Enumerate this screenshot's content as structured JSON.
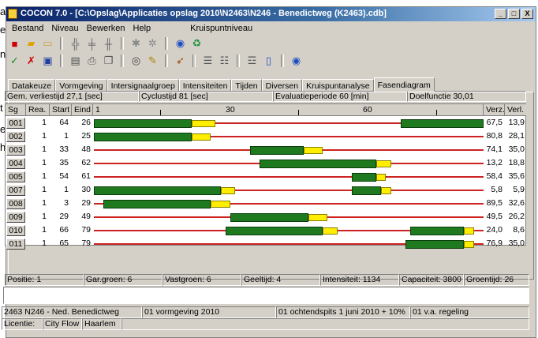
{
  "background_text": [
    "a",
    "e",
    "n",
    "",
    "t",
    "e",
    "h",
    "",
    "",
    "",
    "",
    "",
    "",
    ""
  ],
  "window": {
    "title": "COCON 7.0 - [C:\\Opslag\\Applicaties opslag 2010\\N2463\\N246 - Benedictweg (K2463).cdb]",
    "buttons": [
      "_",
      "□",
      "X"
    ]
  },
  "menu": [
    "Bestand",
    "Niveau",
    "Bewerken",
    "Help",
    "",
    "Kruispuntniveau"
  ],
  "tabs": [
    "Datakeuze",
    "Vormgeving",
    "Intersignaalgroep",
    "Intensiteiten",
    "Tijden",
    "Diversen",
    "Kruispuntanalyse",
    "Fasendiagram"
  ],
  "active_tab": "Fasendiagram",
  "info": {
    "verliestijd": "Gem. verliestijd 27,1 [sec]",
    "cyclustijd": "Cyclustijd 81 [sec]",
    "evaluatie": "Evaluatieperiode 60 [min]",
    "doelfunctie": "Doelfunctie 30,01"
  },
  "grid": {
    "headers": [
      "Sg",
      "Rea.",
      "Start",
      "Eind",
      "1",
      "30",
      "60",
      "Verz.",
      "Verl."
    ],
    "cycle": 81,
    "rows": [
      {
        "sg": "001",
        "rea": "1",
        "start": "64",
        "eind": "26",
        "verz": "67,5",
        "verl": "13,9",
        "bars": [
          [
            64,
            81,
            "g"
          ],
          [
            1,
            21,
            "g"
          ],
          [
            21,
            26,
            "y"
          ]
        ]
      },
      {
        "sg": "002",
        "rea": "1",
        "start": "1",
        "eind": "25",
        "verz": "80,8",
        "verl": "28,1",
        "bars": [
          [
            1,
            21,
            "g"
          ],
          [
            21,
            25,
            "y"
          ]
        ]
      },
      {
        "sg": "003",
        "rea": "1",
        "start": "33",
        "eind": "48",
        "verz": "74,1",
        "verl": "35,0",
        "bars": [
          [
            33,
            44,
            "g"
          ],
          [
            44,
            48,
            "y"
          ]
        ]
      },
      {
        "sg": "004",
        "rea": "1",
        "start": "35",
        "eind": "62",
        "verz": "13,2",
        "verl": "18,8",
        "bars": [
          [
            35,
            59,
            "g"
          ],
          [
            59,
            62,
            "y"
          ]
        ]
      },
      {
        "sg": "005",
        "rea": "1",
        "start": "54",
        "eind": "61",
        "verz": "58,4",
        "verl": "35,6",
        "bars": [
          [
            54,
            59,
            "g"
          ],
          [
            59,
            61,
            "y"
          ]
        ]
      },
      {
        "sg": "007",
        "rea": "1",
        "start": "1",
        "eind": "30",
        "verz": "5,8",
        "verl": "5,9",
        "bars": [
          [
            1,
            27,
            "g"
          ],
          [
            27,
            30,
            "y"
          ],
          [
            54,
            60,
            "g"
          ],
          [
            60,
            62,
            "y"
          ]
        ]
      },
      {
        "sg": "008",
        "rea": "1",
        "start": "3",
        "eind": "29",
        "verz": "89,5",
        "verl": "32,6",
        "bars": [
          [
            3,
            25,
            "g"
          ],
          [
            25,
            29,
            "y"
          ]
        ]
      },
      {
        "sg": "009",
        "rea": "1",
        "start": "29",
        "eind": "49",
        "verz": "49,5",
        "verl": "26,2",
        "bars": [
          [
            29,
            45,
            "g"
          ],
          [
            45,
            49,
            "y"
          ]
        ]
      },
      {
        "sg": "010",
        "rea": "1",
        "start": "66",
        "eind": "79",
        "verz": "24,0",
        "verl": "8,6",
        "bars": [
          [
            28,
            48,
            "g"
          ],
          [
            48,
            51,
            "y"
          ],
          [
            66,
            77,
            "g"
          ],
          [
            77,
            79,
            "y"
          ]
        ]
      },
      {
        "sg": "011",
        "rea": "1",
        "start": "65",
        "eind": "79",
        "verz": "76,9",
        "verl": "35,0",
        "bars": [
          [
            65,
            77,
            "g"
          ],
          [
            77,
            79,
            "y"
          ]
        ]
      }
    ]
  },
  "status": {
    "positie": "Positie: 1",
    "gar_groen": "Gar.groen: 6",
    "vastgroen": "Vastgroen: 6",
    "geeltijd": "Geeltijd: 4",
    "intensiteit": "Intensiteit: 1134",
    "capaciteit": "Capaciteit: 3800",
    "groentijd": "Groentijd: 26"
  },
  "footer": {
    "project": "2463 N246 - Ned. Benedictweg",
    "vormgeving": "01 vormgeving 2010",
    "ochtendspits": "01 ochtendspits 1 juni 2010 + 10%",
    "regeling": "01 v.a. regeling",
    "licentie_label": "Licentie:",
    "licentie_1": "City Flow",
    "licentie_2": "Haarlem"
  },
  "colors": {
    "green": "#1f7a1f",
    "yellow": "#ffee00",
    "red_line": "#cc2222",
    "title_bar": "#0a246a"
  }
}
